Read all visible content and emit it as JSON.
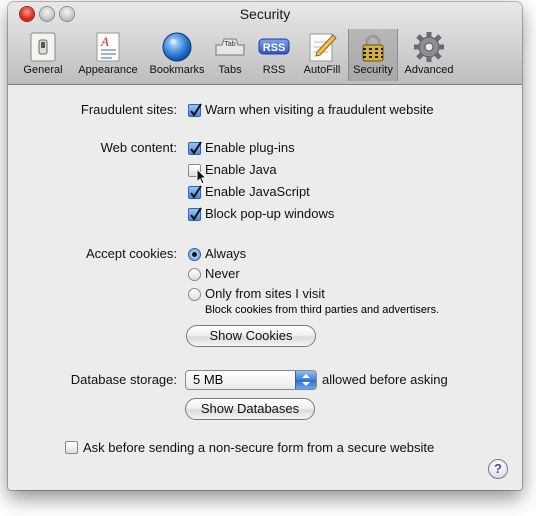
{
  "window": {
    "title": "Security"
  },
  "toolbar": {
    "items": [
      {
        "label": "General",
        "icon": "light-switch-icon"
      },
      {
        "label": "Appearance",
        "icon": "font-document-icon"
      },
      {
        "label": "Bookmarks",
        "icon": "globe-icon"
      },
      {
        "label": "Tabs",
        "icon": "tabs-icon",
        "icon_text": "Tab"
      },
      {
        "label": "RSS",
        "icon": "rss-icon",
        "icon_text": "RSS"
      },
      {
        "label": "AutoFill",
        "icon": "pencil-form-icon"
      },
      {
        "label": "Security",
        "icon": "padlock-icon",
        "selected": true
      },
      {
        "label": "Advanced",
        "icon": "gear-icon"
      }
    ]
  },
  "security": {
    "fraudulent_label": "Fraudulent sites:",
    "fraudulent_option": {
      "label": "Warn when visiting a fraudulent website",
      "checked": true
    },
    "web_content_label": "Web content:",
    "web_content_options": [
      {
        "label": "Enable plug-ins",
        "checked": true
      },
      {
        "label": "Enable Java",
        "checked": false
      },
      {
        "label": "Enable JavaScript",
        "checked": true
      },
      {
        "label": "Block pop-up windows",
        "checked": true
      }
    ],
    "cookies_label": "Accept cookies:",
    "cookie_options": [
      {
        "label": "Always",
        "selected": true
      },
      {
        "label": "Never",
        "selected": false
      },
      {
        "label": "Only from sites I visit",
        "selected": false
      }
    ],
    "cookie_hint": "Block cookies from third parties and advertisers.",
    "show_cookies_button": "Show Cookies",
    "database_label": "Database storage:",
    "database_value": "5 MB",
    "database_suffix": "allowed before asking",
    "show_databases_button": "Show Databases",
    "nonsecure_form_option": {
      "label": "Ask before sending a non-secure form from a secure website",
      "checked": false
    },
    "help_symbol": "?"
  },
  "colors": {
    "accent": "#3e7fd9",
    "window_bg": "#ececec"
  }
}
